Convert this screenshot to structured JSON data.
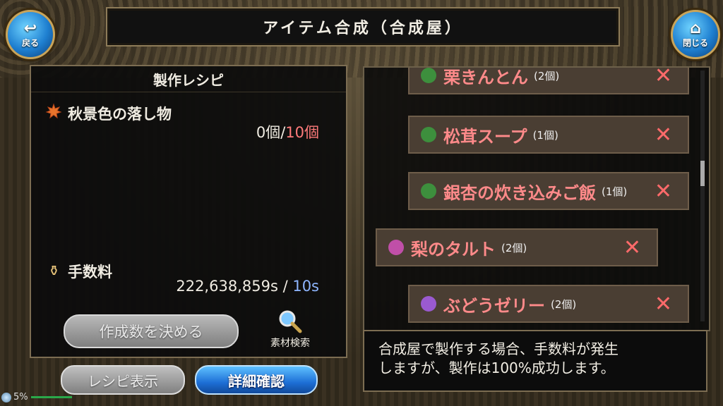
{
  "header": {
    "title": "アイテム合成（合成屋）",
    "back_label": "戻る",
    "close_label": "閉じる"
  },
  "recipe_panel": {
    "title": "製作レシピ",
    "material": {
      "name": "秋景色の落し物",
      "have": "0個",
      "separator": "/",
      "need": "10個"
    },
    "fee": {
      "label": "手数料",
      "value": "222,638,859s",
      "separator": " / ",
      "time": "10s"
    },
    "decide_button": "作成数を決める",
    "search_label": "素材検索"
  },
  "buttons": {
    "recipe_view": "レシピ表示",
    "detail_check": "詳細確認"
  },
  "items": [
    {
      "name": "栗きんとん",
      "qty": "(2個)",
      "icon": "pot-icon",
      "color": "#3d8f3d"
    },
    {
      "name": "松茸スープ",
      "qty": "(1個)",
      "icon": "pot-icon",
      "color": "#3d8f3d"
    },
    {
      "name": "銀杏の炊き込みご飯",
      "qty": "(1個)",
      "icon": "pot-icon",
      "color": "#3d8f3d"
    },
    {
      "name": "梨のタルト",
      "qty": "(2個)",
      "icon": "tart-icon",
      "color": "#c04fa8"
    },
    {
      "name": "ぶどうゼリー",
      "qty": "(2個)",
      "icon": "potion-icon",
      "color": "#9a5ad0"
    }
  ],
  "remove_mark": "✕",
  "info": {
    "line1": "合成屋で製作する場合、手数料が発生",
    "line2": "しますが、製作は100%成功します。"
  },
  "status": {
    "battery": "5%"
  }
}
